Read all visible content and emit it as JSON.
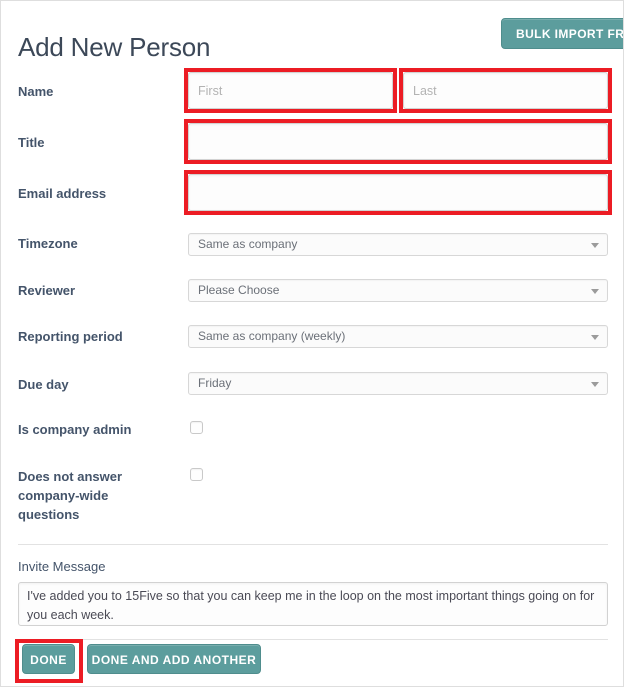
{
  "header": {
    "title": "Add New Person",
    "bulk_import_label": "BULK IMPORT FRO"
  },
  "form": {
    "name": {
      "label": "Name",
      "first_placeholder": "First",
      "first_value": "",
      "last_placeholder": "Last",
      "last_value": ""
    },
    "title": {
      "label": "Title",
      "value": "",
      "placeholder": ""
    },
    "email": {
      "label": "Email address",
      "value": "",
      "placeholder": ""
    },
    "timezone": {
      "label": "Timezone",
      "value": "Same as company"
    },
    "reviewer": {
      "label": "Reviewer",
      "value": "Please Choose"
    },
    "reporting_period": {
      "label": "Reporting period",
      "value": "Same as company (weekly)"
    },
    "due_day": {
      "label": "Due day",
      "value": "Friday"
    },
    "is_company_admin": {
      "label": "Is company admin",
      "checked": false
    },
    "does_not_answer": {
      "label": "Does not answer company-wide questions",
      "checked": false
    }
  },
  "invite": {
    "label": "Invite Message",
    "value": "I've added you to 15Five so that you can keep me in the loop on the most important things going on for you each week."
  },
  "footer": {
    "done_label": "DONE",
    "done_add_another_label": "DONE AND ADD ANOTHER"
  },
  "colors": {
    "teal": "#5c9d9d",
    "annotation_red": "#ec1c24",
    "label_text": "#44546a",
    "title_text": "#3c4858"
  }
}
